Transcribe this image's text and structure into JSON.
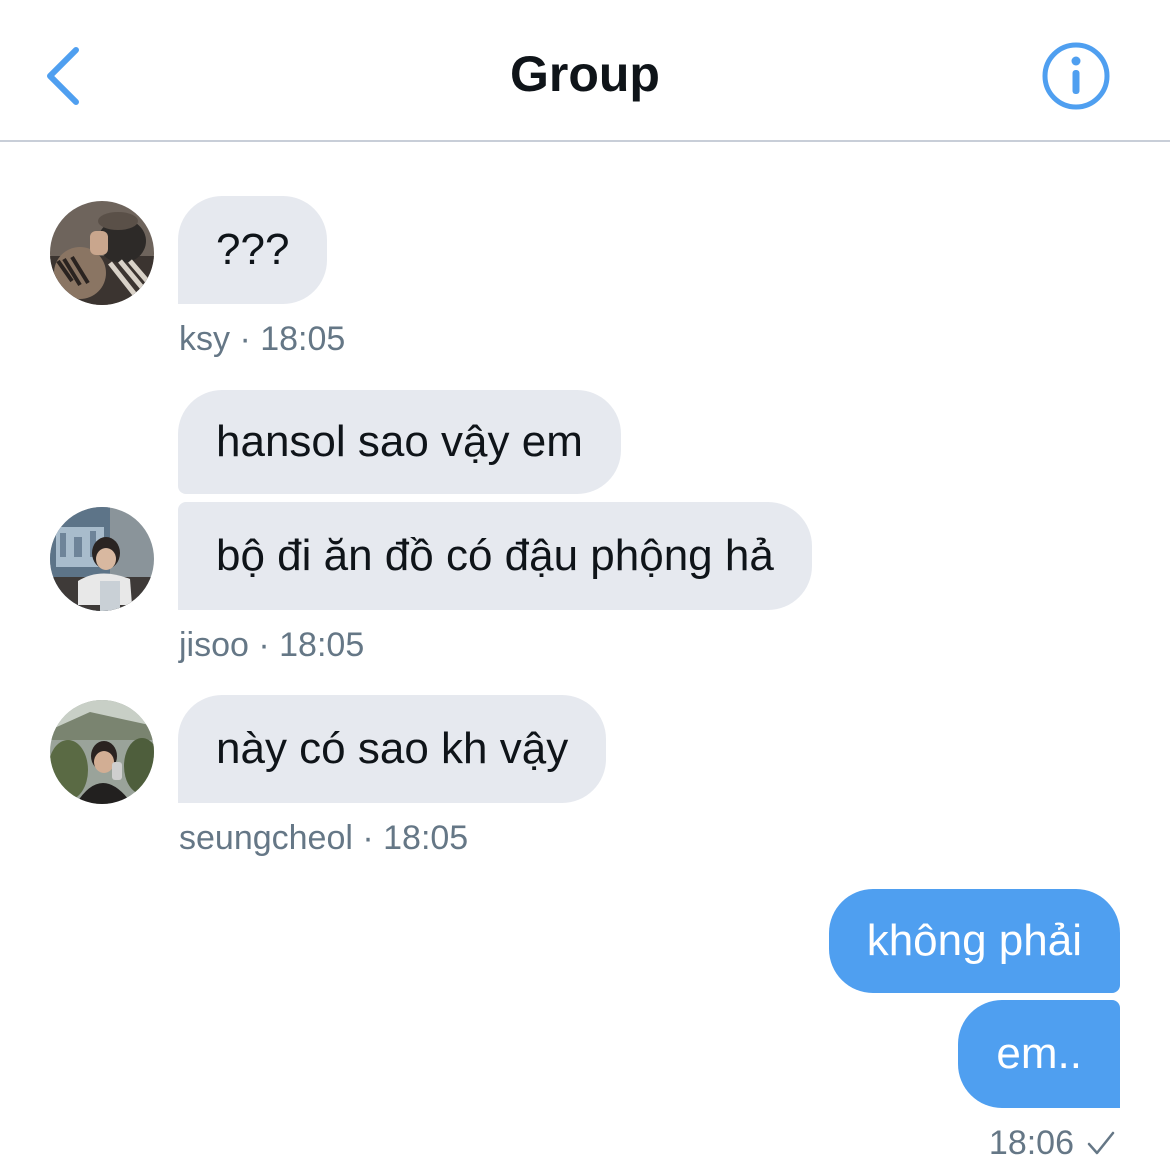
{
  "header": {
    "title": "Group",
    "back_icon": "chevron-left-icon",
    "info_icon": "info-circle-icon",
    "accent_color": "#4f9ff0"
  },
  "messages": [
    {
      "sender": "ksy",
      "text": "???",
      "time": "18:05"
    },
    {
      "sender": "jisoo",
      "text": "hansol sao vậy em",
      "time": "18:05"
    },
    {
      "sender": "jisoo",
      "text": "bộ đi ăn đồ có đậu phộng hả",
      "time": "18:05"
    },
    {
      "sender": "seungcheol",
      "text": "này có sao kh vậy",
      "time": "18:05"
    },
    {
      "sender": "me",
      "text": "không phải",
      "time": "18:06"
    },
    {
      "sender": "me",
      "text": "em..",
      "time": "18:06"
    }
  ],
  "meta": {
    "ksy": "ksy · 18:05",
    "jisoo": "jisoo · 18:05",
    "seungcheol": "seungcheol  · 18:05",
    "me_time": "18:06",
    "me_status_icon": "checkmark-icon"
  },
  "colors": {
    "incoming_bubble": "#e6e9ef",
    "outgoing_bubble": "#4f9ff0",
    "meta_text": "#657786"
  }
}
